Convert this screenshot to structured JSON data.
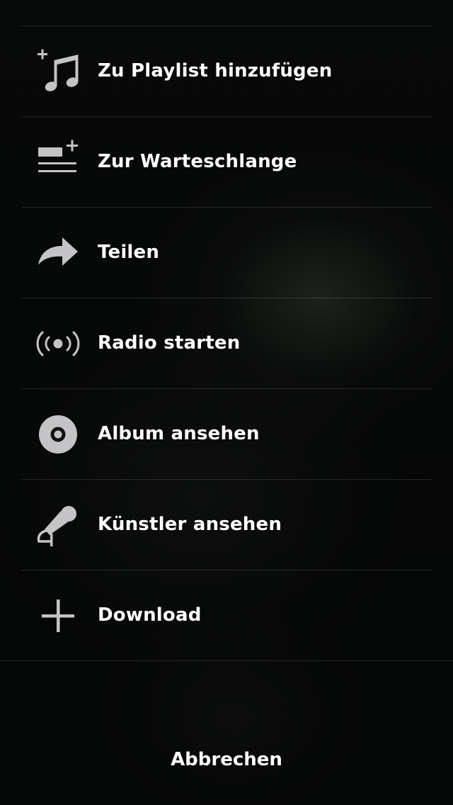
{
  "menu": {
    "items": [
      {
        "id": "add-to-playlist",
        "label": "Zu Playlist hinzufügen",
        "icon": "music-note-plus-icon"
      },
      {
        "id": "add-to-queue",
        "label": "Zur Warteschlange",
        "icon": "queue-add-icon"
      },
      {
        "id": "share",
        "label": "Teilen",
        "icon": "share-arrow-icon"
      },
      {
        "id": "start-radio",
        "label": "Radio starten",
        "icon": "radio-broadcast-icon"
      },
      {
        "id": "view-album",
        "label": "Album ansehen",
        "icon": "disc-icon"
      },
      {
        "id": "view-artist",
        "label": "Künstler ansehen",
        "icon": "microphone-icon"
      },
      {
        "id": "download",
        "label": "Download",
        "icon": "plus-icon"
      }
    ]
  },
  "cancel_label": "Abbrechen",
  "colors": {
    "background": "#050606",
    "icon": "#c4c4c6",
    "text": "#ffffff",
    "separator": "#2a2b2b"
  }
}
